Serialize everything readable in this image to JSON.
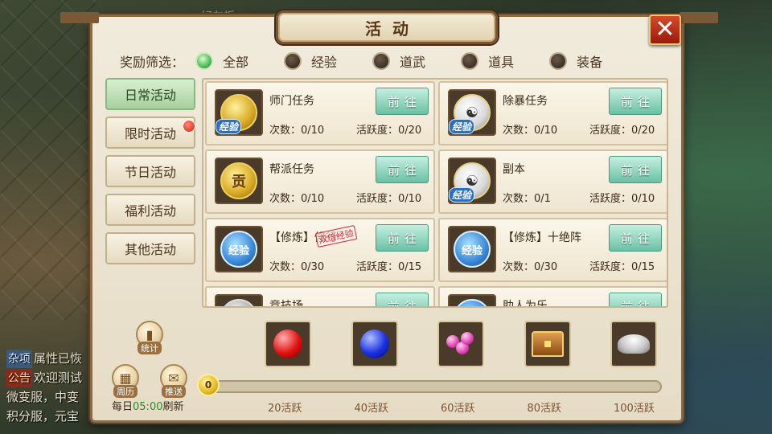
{
  "background": {
    "top_label": "好友板",
    "chat": [
      {
        "tag": "杂项",
        "tag_type": "misc",
        "text": "属性已恢"
      },
      {
        "tag": "公告",
        "tag_type": "notice",
        "text": "欢迎测试"
      },
      {
        "tag": "",
        "tag_type": "",
        "text": "微变服，中变"
      },
      {
        "tag": "",
        "tag_type": "",
        "text": "积分服，元宝"
      }
    ]
  },
  "window": {
    "title": "活动",
    "close_label": "✕"
  },
  "filter": {
    "label": "奖励筛选：",
    "options": [
      {
        "label": "全部",
        "checked": true
      },
      {
        "label": "经验",
        "checked": false
      },
      {
        "label": "道武",
        "checked": false
      },
      {
        "label": "道具",
        "checked": false
      },
      {
        "label": "装备",
        "checked": false
      }
    ]
  },
  "tabs": [
    {
      "label": "日常活动",
      "active": true,
      "badge": false
    },
    {
      "label": "限时活动",
      "active": false,
      "badge": true
    },
    {
      "label": "节日活动",
      "active": false,
      "badge": false
    },
    {
      "label": "福利活动",
      "active": false,
      "badge": false
    },
    {
      "label": "其他活动",
      "active": false,
      "badge": false
    }
  ],
  "activities": [
    {
      "name": "师门任务",
      "icon": "gold-coin-icon",
      "icon_style": "gold",
      "icon_text": "",
      "exp_badge": "经验",
      "stamp": "",
      "count": "次数：0/10",
      "active": "活跃度：0/20",
      "button": "前往"
    },
    {
      "name": "除暴任务",
      "icon": "yinyang-coin-icon",
      "icon_style": "yinyang",
      "icon_text": "☯",
      "exp_badge": "经验",
      "stamp": "",
      "count": "次数：0/10",
      "active": "活跃度：0/20",
      "button": "前往"
    },
    {
      "name": "帮派任务",
      "icon": "gong-coin-icon",
      "icon_style": "gold",
      "icon_text": "贡",
      "exp_badge": "",
      "stamp": "",
      "count": "次数：0/10",
      "active": "活跃度：0/10",
      "button": "前往"
    },
    {
      "name": "副本",
      "icon": "yinyang-coin-icon",
      "icon_style": "yinyang",
      "icon_text": "☯",
      "exp_badge": "经验",
      "stamp": "",
      "count": "次数：0/1",
      "active": "活跃度：0/10",
      "button": "前往"
    },
    {
      "name": "【修炼】修行",
      "icon": "exp-orb-icon",
      "icon_style": "blue",
      "icon_text": "经验",
      "exp_badge": "",
      "stamp": "双倍经验",
      "count": "次数：0/30",
      "active": "活跃度：0/15",
      "button": "前往"
    },
    {
      "name": "【修炼】十绝阵",
      "icon": "exp-orb-icon",
      "icon_style": "blue",
      "icon_text": "经验",
      "exp_badge": "",
      "stamp": "",
      "count": "次数：0/30",
      "active": "活跃度：0/15",
      "button": "前往"
    },
    {
      "name": "竞技场",
      "icon": "silver-coin-icon",
      "icon_style": "silver",
      "icon_text": "",
      "exp_badge": "",
      "stamp": "",
      "count": "",
      "active": "",
      "button": "前往"
    },
    {
      "name": "助人为乐",
      "icon": "scroll-icon",
      "icon_style": "blue",
      "icon_text": "",
      "exp_badge": "",
      "stamp": "",
      "count": "",
      "active": "",
      "button": "前往"
    }
  ],
  "bottom": {
    "stats_label": "统计",
    "calendar_label": "周历",
    "push_label": "推送",
    "daily_prefix": "每日",
    "daily_time": "05:00",
    "daily_suffix": "刷新",
    "progress_value": 0,
    "progress_max": 100,
    "progress_badge": "0",
    "rewards": [
      {
        "icon": "red-gem-icon",
        "milestone": "20活跃"
      },
      {
        "icon": "blue-gem-icon",
        "milestone": "40活跃"
      },
      {
        "icon": "pink-gems-icon",
        "milestone": "60活跃"
      },
      {
        "icon": "treasure-chest-icon",
        "milestone": "80活跃"
      },
      {
        "icon": "silver-ingot-icon",
        "milestone": "100活跃"
      }
    ]
  }
}
